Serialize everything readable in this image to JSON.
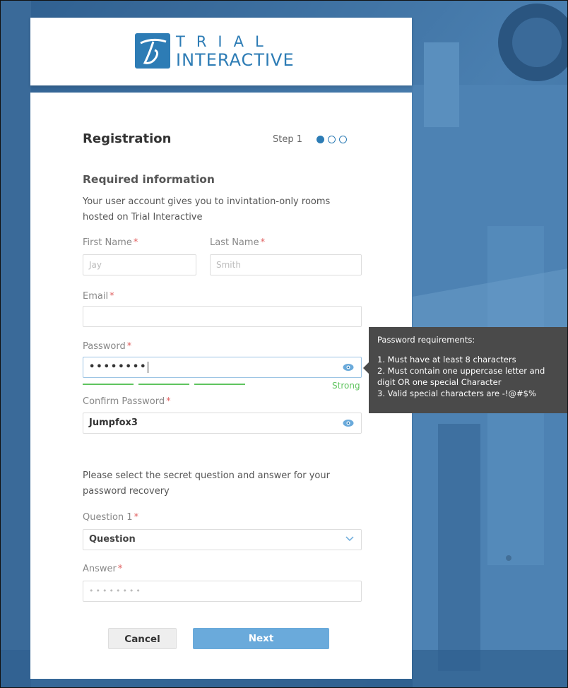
{
  "brand": {
    "line1": "TRIAL",
    "line2": "INTERACTIVE"
  },
  "form": {
    "title": "Registration",
    "step_label": "Step 1",
    "subhead": "Required information",
    "description": "Your user account gives you to invintation-only rooms hosted on Trial Interactive",
    "first_name": {
      "label": "First Name",
      "placeholder": "Jay"
    },
    "last_name": {
      "label": "Last Name",
      "placeholder": "Smith"
    },
    "email": {
      "label": "Email",
      "value": ""
    },
    "password": {
      "label": "Password",
      "masked_value": "••••••••",
      "strength": "Strong"
    },
    "confirm_password": {
      "label": "Confirm Password",
      "value": "Jumpfox3"
    },
    "recovery_text": "Please select the secret question and answer for your password recovery",
    "question": {
      "label": "Question 1",
      "selected": "Question"
    },
    "answer": {
      "label": "Answer",
      "masked_placeholder": "••••••••"
    },
    "required_mark": "*",
    "cancel_label": "Cancel",
    "next_label": "Next"
  },
  "tooltip": {
    "title": "Password requirements:",
    "items": [
      "1. Must have at least 8 characters",
      "2. Must contain one uppercase letter and digit OR one special Character",
      "3. Valid special characters are -!@#$%"
    ]
  },
  "colors": {
    "accent": "#2d7cb5",
    "next_button": "#6aaadb",
    "strength": "#5fc45f",
    "required": "#e06060"
  }
}
